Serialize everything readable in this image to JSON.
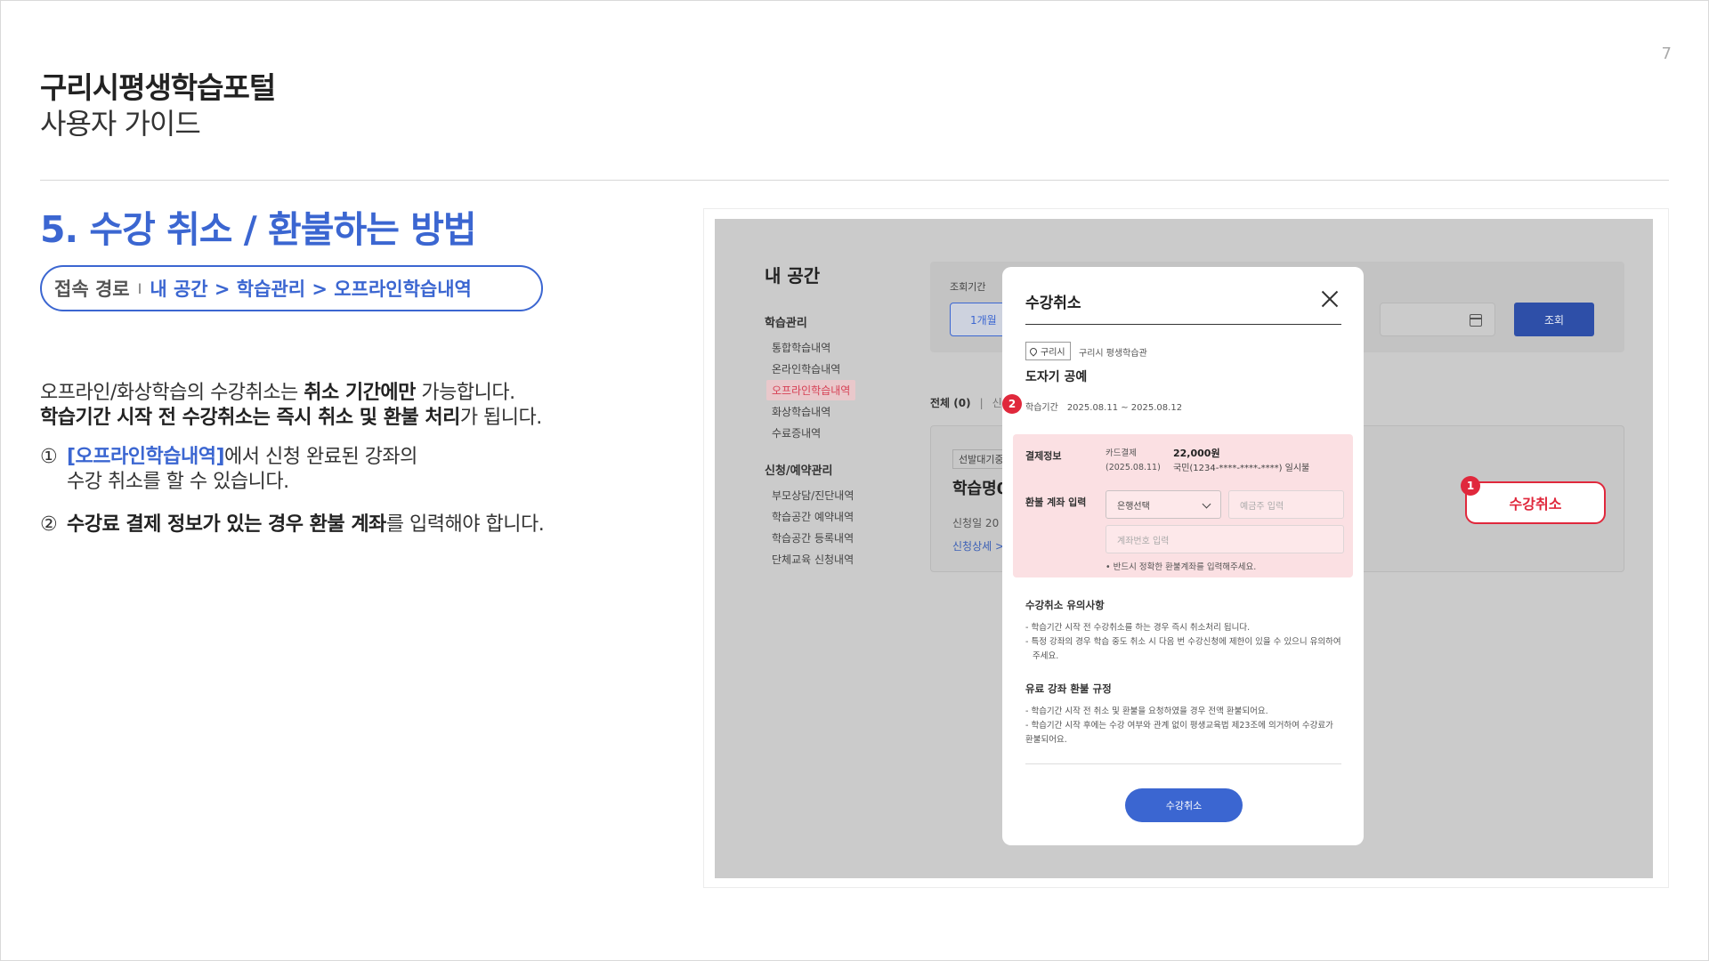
{
  "page": {
    "number": "7",
    "title": "구리시평생학습포털",
    "subtitle": "사용자 가이드"
  },
  "section": {
    "title": "5. 수강 취소 / 환불하는 방법",
    "path_label": "접속 경로",
    "path_separator": "I",
    "path_value": "내 공간 > 학습관리 > 오프라인학습내역"
  },
  "body": {
    "p1_line1_pre": "오프라인/화상학습의 수강취소는 ",
    "p1_line1_bold": "취소 기간에만",
    "p1_line1_post": " 가능합니다.",
    "p1_line2_bold": "학습기간 시작 전 수강취소는 즉시 취소 및 환불 처리",
    "p1_line2_post": "가 됩니다.",
    "p2_num": "①",
    "p2_link": "[오프라인학습내역]",
    "p2_line1_post": "에서 신청 완료된 강좌의",
    "p2_line2": "수강 취소를 할 수 있습니다.",
    "p3_num": "②",
    "p3_bold": "수강료 결제 정보가 있는 경우 환불 계좌",
    "p3_post": "를 입력해야 합니다."
  },
  "screenshot": {
    "sidebar": {
      "title": "내 공간",
      "group1": "학습관리",
      "group1_items": [
        "통합학습내역",
        "온라인학습내역",
        "오프라인학습내역",
        "화상학습내역",
        "수료증내역"
      ],
      "group2": "신청/예약관리",
      "group2_items": [
        "부모상담/진단내역",
        "학습공간 예약내역",
        "학습공간 등록내역",
        "단체교육 신청내역"
      ]
    },
    "filter": {
      "label": "조회기간",
      "period_button": "1개월",
      "search_button": "조회"
    },
    "tabs": {
      "all": "전체 (0)",
      "sep": "|",
      "partial": "신"
    },
    "card": {
      "tag": "선발대기중",
      "name": "학습명0",
      "date": "신청일  20",
      "link": "신청상세 >"
    },
    "cancel_button": "수강취소",
    "badges": [
      "1",
      "2"
    ],
    "modal": {
      "title": "수강취소",
      "location_tag": "구리시",
      "location_name": "구리시 평생학습관",
      "course_name": "도자기 공예",
      "period_label": "학습기간",
      "period_value": "2025.08.11 ~ 2025.08.12",
      "payment_label": "결제정보",
      "payment_method": "카드결제",
      "payment_date": "(2025.08.11)",
      "payment_amount": "22,000원",
      "payment_card": "국민(1234-****-****-****) 일시불",
      "refund_label": "환불 계좌 입력",
      "bank_select": "은행선택",
      "holder_placeholder": "예금주 입력",
      "account_placeholder": "계좌번호 입력",
      "refund_note": "• 반드시 정확한 환불계좌를 입력해주세요.",
      "notice_title": "수강취소 유의사항",
      "notice_lines": [
        "- 학습기간 시작 전 수강취소를 하는 경우 즉시 취소처리 됩니다.",
        "- 특정 강좌의 경우 학습 중도 취소 시 다음 번 수강신청에 제한이 있을 수 있으니 유의하여",
        "  주세요."
      ],
      "policy_title": "유료 강좌 환불 규정",
      "policy_lines": [
        "- 학습기간 시작 전 취소 및 환불을 요청하였을 경우 전액 환불되어요.",
        "- 학습기간 시작 후에는 수강 여부와 관계 없이 평생교육법 제23조에 의거하여 수강료가",
        "환불되어요."
      ],
      "submit_button": "수강취소"
    }
  },
  "colors": {
    "accent": "#3b66d1",
    "highlight_red": "#e0283c",
    "highlight_pink": "#fbe0e3"
  }
}
